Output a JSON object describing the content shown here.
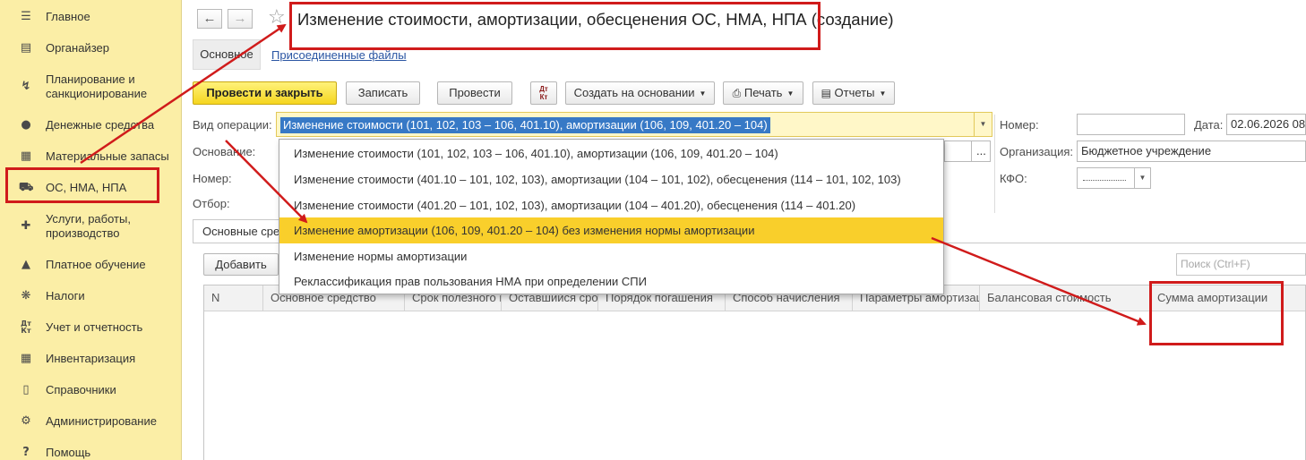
{
  "sidebar": {
    "items": [
      {
        "label": "Главное",
        "icon": "menu-icon"
      },
      {
        "label": "Органайзер",
        "icon": "organizer-icon"
      },
      {
        "label": "Планирование и санкционирование",
        "icon": "planning-icon"
      },
      {
        "label": "Денежные средства",
        "icon": "money-icon"
      },
      {
        "label": "Материальные запасы",
        "icon": "inventory-grid-icon"
      },
      {
        "label": "ОС, НМА, НПА",
        "icon": "truck-icon"
      },
      {
        "label": "Услуги, работы, производство",
        "icon": "tools-icon"
      },
      {
        "label": "Платное обучение",
        "icon": "graduation-cap-icon"
      },
      {
        "label": "Налоги",
        "icon": "eagle-icon"
      },
      {
        "label": "Учет и отчетность",
        "icon": "dt-kt-icon"
      },
      {
        "label": "Инвентаризация",
        "icon": "calculator-icon"
      },
      {
        "label": "Справочники",
        "icon": "book-icon"
      },
      {
        "label": "Администрирование",
        "icon": "gear-icon"
      },
      {
        "label": "Помощь",
        "icon": "help-icon"
      }
    ]
  },
  "header": {
    "title": "Изменение стоимости, амортизации, обесценения ОС, НМА, НПА (создание)",
    "tabs": {
      "main": "Основное",
      "files": "Присоединенные файлы"
    }
  },
  "toolbar": {
    "post_close": "Провести и закрыть",
    "save": "Записать",
    "post": "Провести",
    "dtkt_top": "Дт",
    "dtkt_bottom": "Кт",
    "create_based": "Создать на основании",
    "print": "Печать",
    "reports": "Отчеты"
  },
  "form": {
    "operation_label": "Вид операции:",
    "operation_value": "Изменение стоимости (101, 102, 103 – 106, 401.10), амортизации (106, 109, 401.20 – 104)",
    "basis_label": "Основание:",
    "number_label_left": "Номер:",
    "filter_label": "Отбор:",
    "number_label": "Номер:",
    "number_value": "",
    "date_label": "Дата:",
    "date_value": "02.06.2026  08",
    "org_label": "Организация:",
    "org_value": "Бюджетное учреждение",
    "kfo_label": "КФО:",
    "kfo_value": ""
  },
  "dropdown": {
    "options": [
      "Изменение стоимости (101, 102, 103 – 106, 401.10), амортизации (106, 109, 401.20 – 104)",
      "Изменение стоимости (401.10 – 101, 102, 103), амортизации (104 – 101, 102), обесценения (114 – 101, 102, 103)",
      "Изменение стоимости (401.20 – 101, 102, 103), амортизации (104 – 401.20), обесценения (114 – 401.20)",
      "Изменение амортизации (106, 109, 401.20 – 104) без изменения нормы амортизации",
      "Изменение нормы амортизации",
      "Реклассификация прав пользования НМА при определении СПИ"
    ],
    "highlighted_index": 3
  },
  "table": {
    "tab_label": "Основные средства",
    "add_button": "Добавить",
    "search_placeholder": "Поиск (Ctrl+F)",
    "columns": [
      "N",
      "Основное средство",
      "Срок полезного использования",
      "Оставшийся срок",
      "Порядок погашения",
      "Способ начисления",
      "Параметры амортизации",
      "Балансовая стоимость",
      "Сумма амортизации"
    ]
  },
  "colors": {
    "sidebar_bg": "#fbeea6",
    "primary_button": "#f5d51f",
    "dropdown_highlight": "#f9cf2b",
    "annotation_red": "#d01b1b",
    "link_blue": "#2a55a3"
  }
}
